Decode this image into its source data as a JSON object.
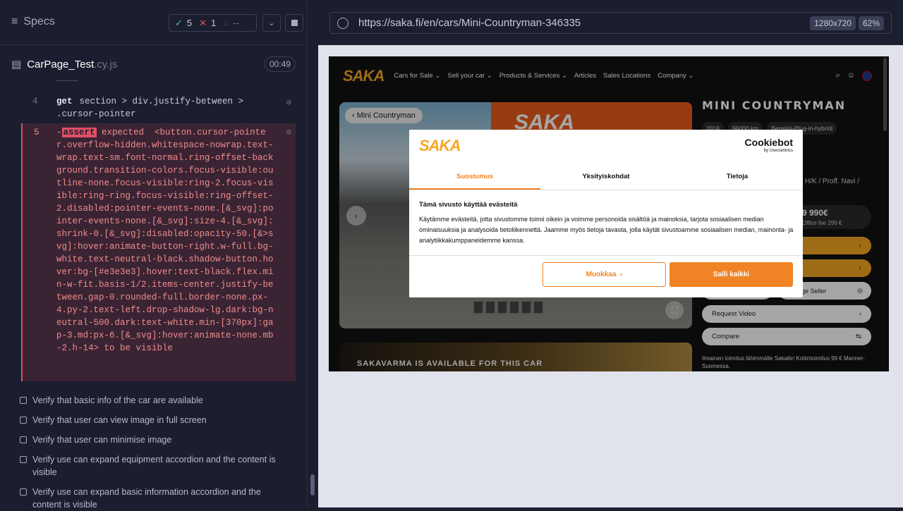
{
  "sidebar": {
    "title": "Specs",
    "stats": {
      "passed": "5",
      "failed": "1",
      "pending": "--"
    },
    "file": {
      "name": "CarPage_Test",
      "ext": ".cy.js",
      "time": "00:49"
    },
    "commands": [
      {
        "num": "4",
        "name": "get",
        "selector": "section > div.justify-between > .cursor-pointer"
      },
      {
        "num": "5",
        "prefix": "-",
        "name": "assert",
        "message": "expected  <button.cursor-pointer.overflow-hidden.whitespace-nowrap.text-wrap.text-sm.font-normal.ring-offset-background.transition-colors.focus-visible:outline-none.focus-visible:ring-2.focus-visible:ring-ring.focus-visible:ring-offset-2.disabled:pointer-events-none.[&_svg]:pointer-events-none.[&_svg]:size-4.[&_svg]:shrink-0.[&_svg]:disabled:opacity-50.[&>svg]:hover:animate-button-right.w-full.bg-white.text-neutral-black.shadow-button.hover:bg-[#e3e3e3].hover:text-black.flex.min-w-fit.basis-1/2.items-center.justify-between.gap-0.rounded-full.border-none.px-4.py-2.text-left.drop-shadow-lg.dark:bg-neutral-500.dark:text-white.min-[370px]:gap-3.md:px-6.[&_svg]:hover:animate-none.mb-2.h-14>",
        "suffix": "to be visible"
      }
    ],
    "tests": [
      "Verify that basic info of the car are available",
      "Verify that user can view image in full screen",
      "Verify that user can minimise image",
      "Verify use can expand equipment accordion and the content is visible",
      "Verify use can expand basic information accordion and the content is visible"
    ]
  },
  "browser": {
    "url": "https://saka.fi/en/cars/Mini-Countryman-346335",
    "viewport_size": "1280x720",
    "zoom": "62%"
  },
  "site": {
    "logo": "SAKA",
    "nav": [
      "Cars for Sale",
      "Sell your car",
      "Products & Services",
      "Articles",
      "Sales Locations",
      "Company"
    ],
    "back_label": "Mini Countryman",
    "car_title": "MINI COUNTRYMAN",
    "chips": [
      "2018",
      "96000 km",
      "Bensiini-Plug-in-hybridi"
    ],
    "variant": "H/K / Proff. Navi /",
    "price": "9 990€",
    "fee": "Office fee 299 €",
    "message_seller": "age Seller",
    "request_video": "Request Video",
    "compare": "Compare",
    "sakavarma": "SAKAVARMA IS AVAILABLE FOR THIS CAR",
    "delivery": "Ilmainen toimitus lähimmälle Sakalle! Kotiintoimitus 99 € Manner-Suomessa."
  },
  "cookie": {
    "logo": "SAKA",
    "brand": "Cookiebot",
    "brand_sub": "by Usercentrics",
    "tabs": [
      "Suostumus",
      "Yksityiskohdat",
      "Tietoja"
    ],
    "heading": "Tämä sivusto käyttää evästeitä",
    "body": "Käytämme evästeitä, jotta sivustomme toimii oikein ja voimme personoida sisältöä ja mainoksia, tarjota sosiaalisen median ominaisuuksia ja analysoida tietoliikennettä. Jaamme myös tietoja tavasta, jolla käytät sivustoamme sosiaalisen median, mainonta- ja analytiikkakumppaneidemme kanssa.",
    "btn_customize": "Muokkaa",
    "btn_allow": "Salli kaikki"
  }
}
